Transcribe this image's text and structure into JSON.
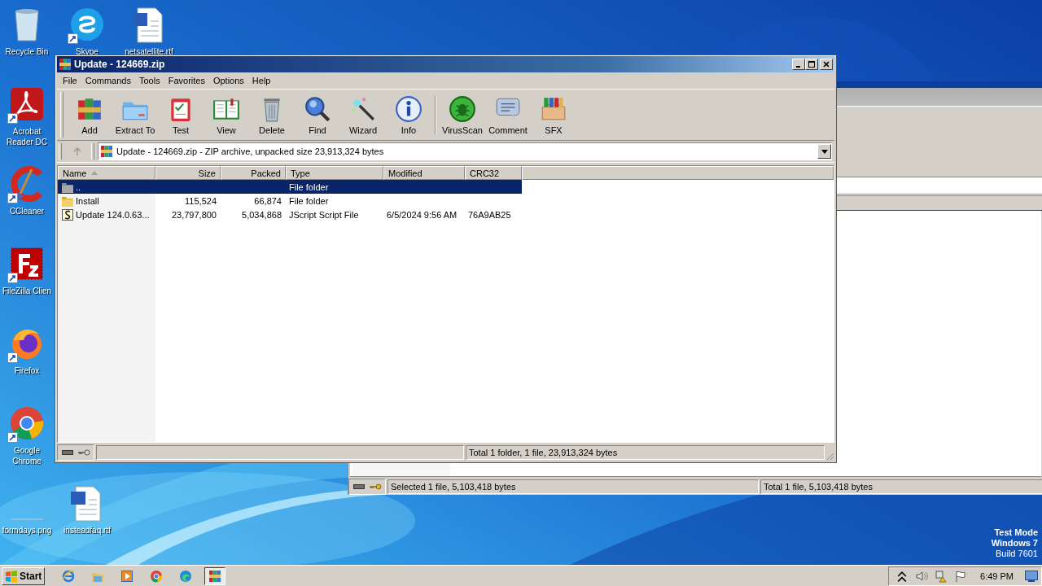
{
  "desktop_icons": [
    {
      "label": "Recycle Bin",
      "shortcut": false
    },
    {
      "label": "Skype",
      "shortcut": true
    },
    {
      "label": "netsatellite.rtf",
      "shortcut": false
    },
    {
      "label": "Acrobat Reader DC",
      "shortcut": true
    },
    {
      "label": "CCleaner",
      "shortcut": true
    },
    {
      "label": "FileZilla Clien",
      "shortcut": true
    },
    {
      "label": "Firefox",
      "shortcut": true
    },
    {
      "label": "Google Chrome",
      "shortcut": true
    },
    {
      "label": "formdays.png",
      "shortcut": false
    },
    {
      "label": "insteadfaq.rtf",
      "shortcut": false
    }
  ],
  "background_window": {
    "status_left": "Selected 1 file, 5,103,418 bytes",
    "status_right": "Total 1 file, 5,103,418 bytes"
  },
  "window": {
    "title": "Update - 124669.zip",
    "menu": [
      "File",
      "Commands",
      "Tools",
      "Favorites",
      "Options",
      "Help"
    ],
    "toolbar": [
      {
        "label": "Add"
      },
      {
        "label": "Extract To"
      },
      {
        "label": "Test"
      },
      {
        "label": "View"
      },
      {
        "label": "Delete"
      },
      {
        "label": "Find"
      },
      {
        "label": "Wizard"
      },
      {
        "label": "Info"
      },
      {
        "label": "VirusScan"
      },
      {
        "label": "Comment"
      },
      {
        "label": "SFX"
      }
    ],
    "address": "Update - 124669.zip - ZIP archive, unpacked size 23,913,324 bytes",
    "columns": [
      {
        "label": "Name",
        "sorted": true
      },
      {
        "label": "Size",
        "sorted": false
      },
      {
        "label": "Packed",
        "sorted": false
      },
      {
        "label": "Type",
        "sorted": false
      },
      {
        "label": "Modified",
        "sorted": false
      },
      {
        "label": "CRC32",
        "sorted": false
      }
    ],
    "rows": [
      {
        "kind": "parent",
        "name": "..",
        "type": "File folder",
        "selected": true
      },
      {
        "kind": "folder",
        "name": "Install",
        "size": "115,524",
        "packed": "66,874",
        "type": "File folder",
        "selected": false
      },
      {
        "kind": "file",
        "name": "Update 124.0.63...",
        "size": "23,797,800",
        "packed": "5,034,868",
        "type": "JScript Script File",
        "modified": "6/5/2024 9:56 AM",
        "crc32": "76A9AB25",
        "selected": false
      }
    ],
    "status": "Total 1 folder, 1 file, 23,913,324 bytes"
  },
  "os_notice": [
    "Test Mode",
    "Windows 7",
    "Build 7601"
  ],
  "taskbar": {
    "start": "Start",
    "apps": [
      {
        "selected": false
      },
      {
        "selected": false
      },
      {
        "selected": false
      },
      {
        "selected": false
      },
      {
        "selected": false
      },
      {
        "selected": true
      }
    ],
    "clock": "6:49 PM"
  }
}
